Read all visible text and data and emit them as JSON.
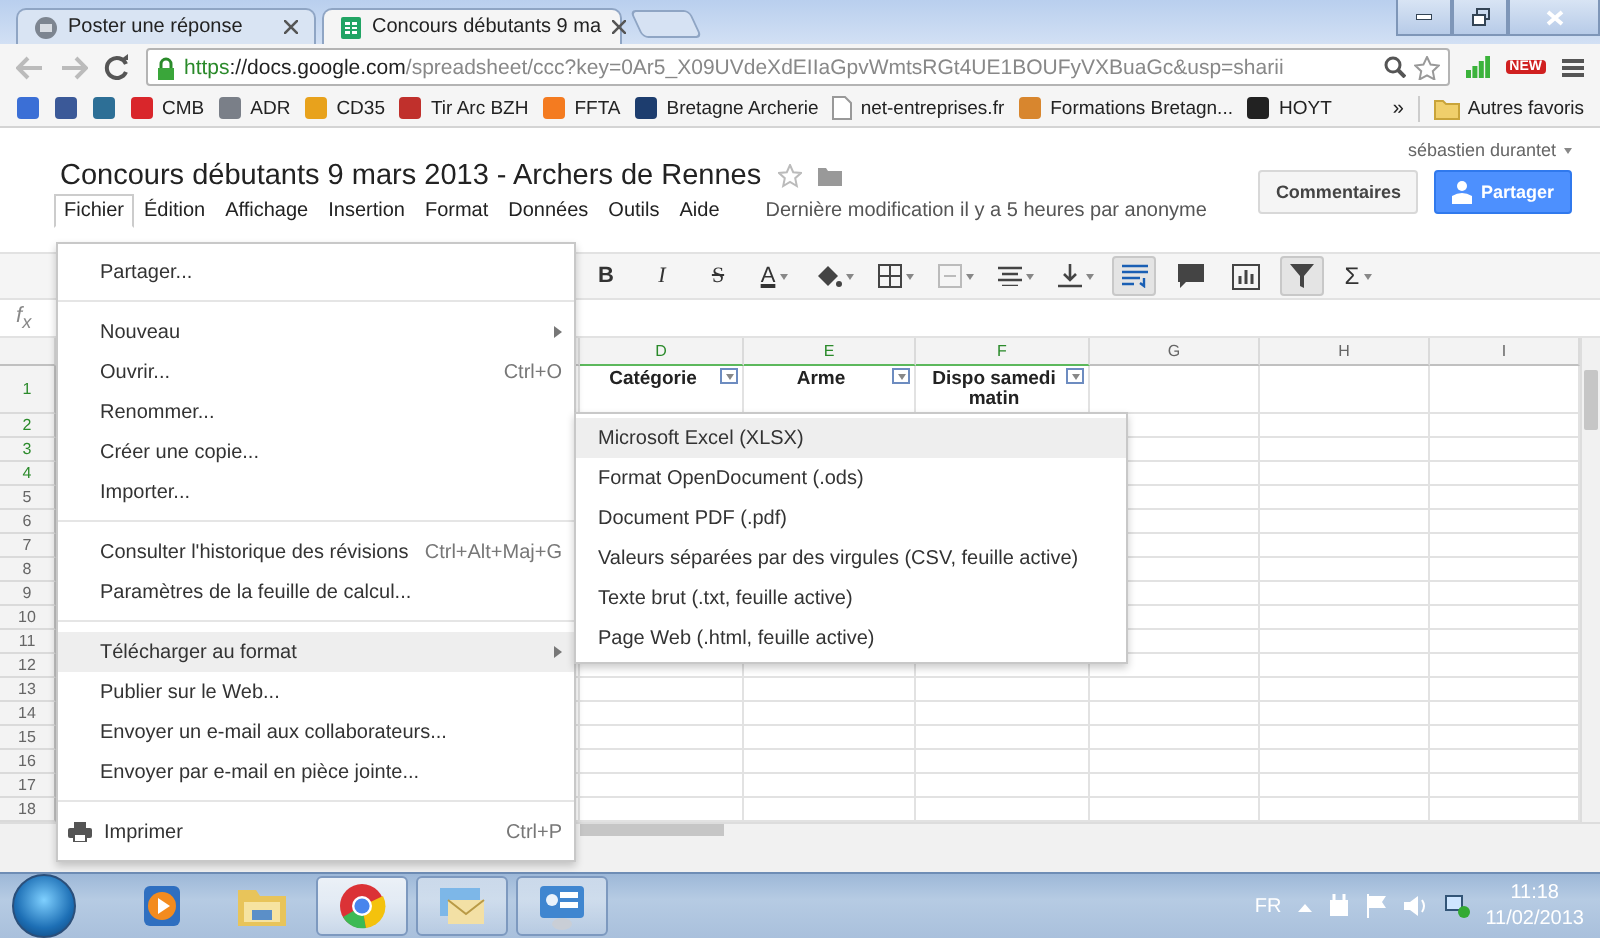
{
  "browser": {
    "tabs": [
      {
        "title": "Poster une réponse",
        "kind": "forum",
        "selected": false
      },
      {
        "title": "Concours débutants 9 ma",
        "kind": "sheets",
        "selected": true
      }
    ],
    "url": {
      "scheme": "https",
      "host": "://docs.google.com",
      "path": "/spreadsheet/ccc?key=0Ar5_X09UVdeXdEIIaGpvWmtsRGt4UE1BOUFyVXBuaGc&usp=sharii"
    },
    "extension_badge": "NEW",
    "bookmarks": [
      {
        "kind": "icon",
        "color": "#3b6fd6"
      },
      {
        "kind": "icon",
        "color": "#3b5998"
      },
      {
        "kind": "icon",
        "color": "#2d6f96"
      },
      {
        "kind": "link",
        "label": "CMB",
        "color": "#d9262b"
      },
      {
        "kind": "link",
        "label": "ADR",
        "color": "#7a7f88"
      },
      {
        "kind": "link",
        "label": "CD35",
        "color": "#e8a21c"
      },
      {
        "kind": "link",
        "label": "Tir Arc BZH",
        "color": "#c0302c"
      },
      {
        "kind": "link",
        "label": "FFTA",
        "color": "#f47b20"
      },
      {
        "kind": "link",
        "label": "Bretagne Archerie",
        "color": "#1d3d6e"
      },
      {
        "kind": "page",
        "label": "net-entreprises.fr",
        "color": "#ffffff"
      },
      {
        "kind": "link",
        "label": "Formations Bretagn...",
        "color": "#d8862e"
      },
      {
        "kind": "link",
        "label": "HOYT",
        "color": "#222222"
      }
    ],
    "bookmarks_overflow": "»",
    "other_bookmarks": "Autres favoris"
  },
  "document": {
    "title": "Concours débutants 9 mars 2013 - Archers de Rennes",
    "user": "sébastien durantet",
    "buttons": [
      {
        "label": "Commentaires",
        "kind": "plain"
      },
      {
        "label": "Partager",
        "kind": "primary"
      }
    ],
    "menus": [
      {
        "label": "Fichier",
        "selected": true
      },
      {
        "label": "Édition",
        "selected": false
      },
      {
        "label": "Affichage",
        "selected": false
      },
      {
        "label": "Insertion",
        "selected": false
      },
      {
        "label": "Format",
        "selected": false
      },
      {
        "label": "Données",
        "selected": false
      },
      {
        "label": "Outils",
        "selected": false
      },
      {
        "label": "Aide",
        "selected": false
      }
    ],
    "last_edit": "Dernière modification il y a 5 heures par anonyme"
  },
  "toolbar": [
    {
      "kind": "bold",
      "label": "B",
      "on": false,
      "dropdown": false
    },
    {
      "kind": "italic",
      "label": "I",
      "on": false,
      "dropdown": false
    },
    {
      "kind": "strike",
      "label": "S",
      "on": false,
      "dropdown": false
    },
    {
      "kind": "color",
      "label": "A",
      "on": false,
      "dropdown": true
    },
    {
      "kind": "fill",
      "on": false,
      "dropdown": true
    },
    {
      "kind": "borders",
      "on": false,
      "dropdown": true
    },
    {
      "kind": "merge",
      "on": false,
      "dropdown": true
    },
    {
      "kind": "align",
      "on": false,
      "dropdown": true
    },
    {
      "kind": "valign",
      "on": false,
      "dropdown": true
    },
    {
      "kind": "wrap",
      "on": true,
      "dropdown": false
    },
    {
      "kind": "comment",
      "on": false,
      "dropdown": false
    },
    {
      "kind": "chart",
      "on": false,
      "dropdown": false
    },
    {
      "kind": "filter",
      "on": true,
      "dropdown": false
    },
    {
      "kind": "sum",
      "label": "Σ",
      "on": false,
      "dropdown": true
    }
  ],
  "formula_label": "f$_{x}$",
  "sheet": {
    "columns": [
      {
        "letter": "D",
        "selected": true,
        "header": "Catégorie",
        "filter": true
      },
      {
        "letter": "E",
        "selected": true,
        "header": "Arme",
        "filter": true
      },
      {
        "letter": "F",
        "selected": true,
        "header": "Dispo samedi matin",
        "filter": true
      },
      {
        "letter": "G",
        "selected": false,
        "filter": false
      },
      {
        "letter": "H",
        "selected": false,
        "filter": false
      },
      {
        "letter": "I",
        "selected": false,
        "filter": false
      }
    ],
    "rows": [
      {
        "number": "1",
        "selected": true
      },
      {
        "number": "2",
        "selected": true
      },
      {
        "number": "3",
        "selected": true
      },
      {
        "number": "4",
        "selected": true
      },
      {
        "number": "5",
        "selected": false
      },
      {
        "number": "6",
        "selected": false
      },
      {
        "number": "7",
        "selected": false
      },
      {
        "number": "8",
        "selected": false
      },
      {
        "number": "9",
        "selected": false
      },
      {
        "number": "10",
        "selected": false
      },
      {
        "number": "11",
        "selected": false
      },
      {
        "number": "12",
        "selected": false
      },
      {
        "number": "13",
        "selected": false
      },
      {
        "number": "14",
        "selected": false
      },
      {
        "number": "15",
        "selected": false
      },
      {
        "number": "16",
        "selected": false
      },
      {
        "number": "17",
        "selected": false
      },
      {
        "number": "18",
        "selected": false
      }
    ]
  },
  "file_menu": [
    {
      "kind": "item",
      "label": "Partager...",
      "selected": false
    },
    {
      "kind": "separator"
    },
    {
      "kind": "item",
      "label": "Nouveau",
      "submenu": true,
      "selected": false
    },
    {
      "kind": "item",
      "label": "Ouvrir...",
      "shortcut": "Ctrl+O",
      "selected": false
    },
    {
      "kind": "item",
      "label": "Renommer...",
      "selected": false
    },
    {
      "kind": "item",
      "label": "Créer une copie...",
      "selected": false
    },
    {
      "kind": "item",
      "label": "Importer...",
      "selected": false
    },
    {
      "kind": "separator"
    },
    {
      "kind": "item",
      "label": "Consulter l'historique des révisions",
      "shortcut": "Ctrl+Alt+Maj+G",
      "selected": false
    },
    {
      "kind": "item",
      "label": "Paramètres de la feuille de calcul...",
      "selected": false
    },
    {
      "kind": "separator"
    },
    {
      "kind": "item",
      "label": "Télécharger au format",
      "submenu": true,
      "selected": true
    },
    {
      "kind": "item",
      "label": "Publier sur le Web...",
      "selected": false
    },
    {
      "kind": "item",
      "label": "Envoyer un e-mail aux collaborateurs...",
      "selected": false
    },
    {
      "kind": "item",
      "label": "Envoyer par e-mail en pièce jointe...",
      "selected": false
    },
    {
      "kind": "separator"
    },
    {
      "kind": "print",
      "label": "Imprimer",
      "shortcut": "Ctrl+P",
      "selected": false
    }
  ],
  "download_menu": [
    {
      "label": "Microsoft Excel (XLSX)",
      "selected": true
    },
    {
      "label": "Format OpenDocument (.ods)",
      "selected": false
    },
    {
      "label": "Document PDF (.pdf)",
      "selected": false
    },
    {
      "label": "Valeurs séparées par des virgules (CSV, feuille active)",
      "selected": false
    },
    {
      "label": "Texte brut (.txt, feuille active)",
      "selected": false
    },
    {
      "label": "Page Web (.html, feuille active)",
      "selected": false
    }
  ],
  "taskbar": {
    "apps": [
      {
        "kind": "media",
        "running": false,
        "selected": false
      },
      {
        "kind": "explorer",
        "running": false,
        "selected": false
      },
      {
        "kind": "chrome",
        "running": true,
        "selected": true
      },
      {
        "kind": "mail",
        "running": true,
        "selected": false
      },
      {
        "kind": "control",
        "running": true,
        "selected": false
      }
    ],
    "language": "FR",
    "time": "11:18",
    "date": "11/02/2013"
  }
}
